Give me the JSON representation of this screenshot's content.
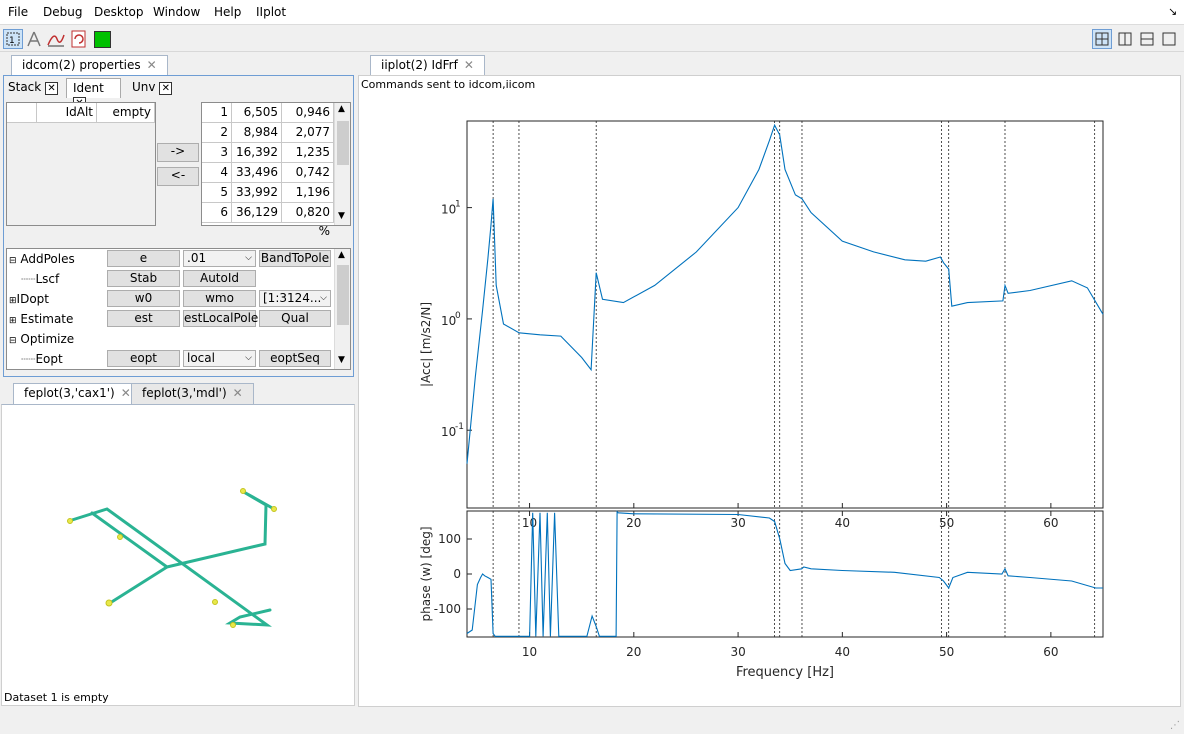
{
  "menu": {
    "file": "File",
    "debug": "Debug",
    "desktop": "Desktop",
    "window": "Window",
    "help": "Help",
    "iiplot": "IIplot",
    "corner": "↘"
  },
  "left_tabs": {
    "main": "idcom(2) properties",
    "stack": "Stack",
    "ident": "Ident",
    "unv": "Unv"
  },
  "ident_table": {
    "col1": "IdAlt",
    "col2": "empty"
  },
  "arrows": {
    "right": "->",
    "left": "<-"
  },
  "modes": [
    {
      "n": "1",
      "f": "6,505",
      "d": "0,946 %"
    },
    {
      "n": "2",
      "f": "8,984",
      "d": "2,077 %"
    },
    {
      "n": "3",
      "f": "16,392",
      "d": "1,235 %"
    },
    {
      "n": "4",
      "f": "33,496",
      "d": "0,742 %"
    },
    {
      "n": "5",
      "f": "33,992",
      "d": "1,196 %"
    },
    {
      "n": "6",
      "f": "36,129",
      "d": "0,820 %"
    }
  ],
  "tree": {
    "addpoles": "AddPoles",
    "addpoles_e": "e",
    "addpoles_val": ".01",
    "addpoles_btn": "BandToPole",
    "lscf": "Lscf",
    "lscf_stab": "Stab",
    "lscf_autoid": "AutoId",
    "idopt": "IDopt",
    "idopt_w0": "w0",
    "idopt_wmo": "wmo",
    "idopt_range": "[1:3124...",
    "estimate": "Estimate",
    "estimate_est": "est",
    "estimate_local": "estLocalPole",
    "estimate_qual": "Qual",
    "optimize": "Optimize",
    "eopt": "Eopt",
    "eopt_btn": "eopt",
    "eopt_local": "local",
    "eopt_seq": "eoptSeq"
  },
  "feplot_tabs": {
    "t1": "feplot(3,'cax1')",
    "t2": "feplot(3,'mdl')"
  },
  "status": "Dataset 1 is empty",
  "iiplot": {
    "tab": "iiplot(2) IdFrf",
    "msg": "Commands sent to idcom,iicom"
  },
  "chart_data": {
    "type": "line",
    "title": "",
    "xlabel": "Frequency [Hz]",
    "ylabel_top": "|Acc| [m/s2/N]",
    "ylabel_bottom": "phase (w) [deg]",
    "xlim": [
      4,
      65
    ],
    "ylim_top": [
      0.02,
      60
    ],
    "ylim_bottom": [
      -180,
      180
    ],
    "yscale_top": "log",
    "x_ticks": [
      "10",
      "20",
      "30",
      "40",
      "50",
      "60"
    ],
    "y_ticks_top": [
      "10",
      "10",
      "10"
    ],
    "y_ticks_top_exp": [
      "1",
      "0",
      "-1"
    ],
    "y_ticks_bottom": [
      "100",
      "0",
      "-100"
    ],
    "pole_lines": [
      6.505,
      8.984,
      16.392,
      33.496,
      33.992,
      36.129,
      49.5,
      50.2,
      55.6,
      64.2
    ],
    "amplitude": {
      "x": [
        4,
        4.8,
        5.5,
        6,
        6.3,
        6.505,
        6.8,
        7.5,
        9,
        11,
        13,
        15,
        15.9,
        16.392,
        17,
        19,
        22,
        26,
        30,
        32,
        33,
        33.5,
        33.99,
        34.5,
        35.5,
        36.129,
        37,
        40,
        43,
        46,
        48,
        49.4,
        49.7,
        50.2,
        50.5,
        52,
        55.4,
        55.6,
        55.9,
        58,
        62,
        63.5,
        65
      ],
      "y": [
        0.05,
        0.3,
        1.2,
        3.5,
        7,
        12,
        2,
        0.9,
        0.75,
        0.72,
        0.7,
        0.45,
        0.35,
        2.6,
        1.5,
        1.4,
        2,
        4,
        10,
        22,
        40,
        55,
        45,
        22,
        13,
        12,
        9,
        5,
        4,
        3.4,
        3.3,
        3.6,
        3.2,
        2.8,
        1.3,
        1.4,
        1.45,
        2.0,
        1.7,
        1.8,
        2.2,
        1.9,
        1.1
      ]
    },
    "phase": {
      "x": [
        4,
        4.5,
        5,
        5.3,
        5.5,
        5.7,
        6,
        6.3,
        6.5,
        6.7,
        7,
        9,
        9.6,
        10,
        10.3,
        10.6,
        11,
        11.3,
        11.7,
        12,
        12.4,
        12.8,
        13.5,
        15.5,
        16,
        16.39,
        16.7,
        17,
        18.3,
        18.4,
        18.5,
        20,
        30,
        33,
        33.5,
        34,
        34.5,
        35,
        36.1,
        36.3,
        37,
        40,
        45,
        49.3,
        49.7,
        50.2,
        50.6,
        52,
        55.3,
        55.6,
        55.9,
        58,
        62,
        64.3,
        65
      ],
      "y": [
        -170,
        -160,
        -30,
        -10,
        0,
        -5,
        -10,
        -15,
        -170,
        -178,
        -178,
        -178,
        -178,
        -178,
        175,
        -178,
        175,
        -178,
        175,
        -178,
        175,
        -178,
        -178,
        -178,
        -120,
        -150,
        -178,
        -178,
        -178,
        178,
        175,
        172,
        170,
        160,
        150,
        100,
        30,
        10,
        15,
        20,
        15,
        10,
        5,
        -10,
        -20,
        -40,
        -10,
        5,
        0,
        15,
        -5,
        -10,
        -20,
        -40,
        -40
      ]
    }
  }
}
